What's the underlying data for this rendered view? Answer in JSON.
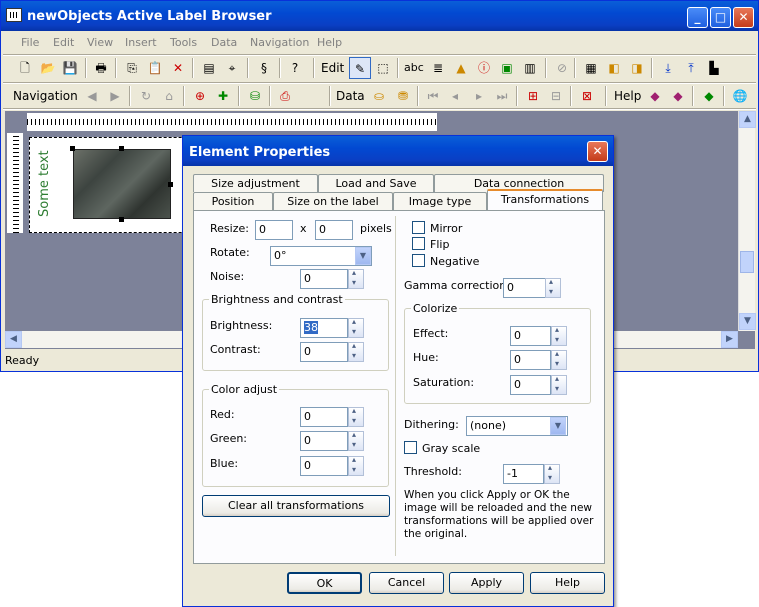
{
  "app": {
    "title": "newObjects Active Label Browser",
    "menu": [
      "File",
      "Edit",
      "View",
      "Insert",
      "Tools",
      "Data",
      "Navigation",
      "Help"
    ],
    "toolbar": {
      "edit_label": "Edit",
      "navigation_label": "Navigation",
      "data_label": "Data",
      "help_label": "Help",
      "abc_label": "abc"
    },
    "canvas": {
      "rotated_text": "Some text"
    },
    "status": "Ready"
  },
  "dialog": {
    "title": "Element Properties",
    "tabs_row1": [
      "Size adjustment",
      "Load and Save",
      "Data connection"
    ],
    "tabs_row2": [
      "Position",
      "Size on the label",
      "Image type",
      "Transformations"
    ],
    "active_tab": "Transformations",
    "resize": {
      "label": "Resize:",
      "width": "0",
      "x": "x",
      "height": "0",
      "unit": "pixels"
    },
    "rotate": {
      "label": "Rotate:",
      "value": "0°"
    },
    "noise": {
      "label": "Noise:",
      "value": "0"
    },
    "brightness_group": {
      "title": "Brightness and contrast",
      "brightness_label": "Brightness:",
      "brightness_value": "38",
      "contrast_label": "Contrast:",
      "contrast_value": "0"
    },
    "color_group": {
      "title": "Color adjust",
      "red_label": "Red:",
      "red_value": "0",
      "green_label": "Green:",
      "green_value": "0",
      "blue_label": "Blue:",
      "blue_value": "0"
    },
    "clear_button": "Clear all transformations",
    "mirror_label": "Mirror",
    "flip_label": "Flip",
    "negative_label": "Negative",
    "gamma": {
      "label": "Gamma correction:",
      "value": "0"
    },
    "colorize_group": {
      "title": "Colorize",
      "effect_label": "Effect:",
      "effect_value": "0",
      "hue_label": "Hue:",
      "hue_value": "0",
      "saturation_label": "Saturation:",
      "saturation_value": "0"
    },
    "dithering": {
      "label": "Dithering:",
      "value": "(none)"
    },
    "grayscale_label": "Gray scale",
    "threshold": {
      "label": "Threshold:",
      "value": "-1"
    },
    "note": "When you click Apply or OK the image will be reloaded and the new transformations will be applied over the original.",
    "buttons": {
      "ok": "OK",
      "cancel": "Cancel",
      "apply": "Apply",
      "help": "Help"
    }
  }
}
